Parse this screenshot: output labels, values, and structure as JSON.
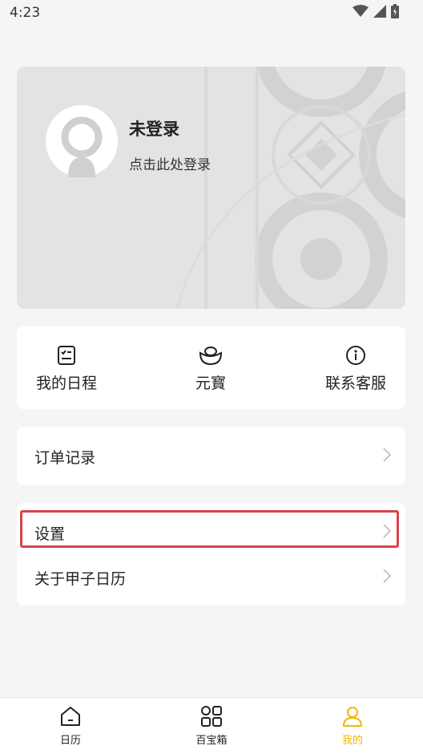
{
  "status_bar": {
    "time": "4:23"
  },
  "profile": {
    "title": "未登录",
    "subtitle": "点击此处登录"
  },
  "shortcuts": [
    {
      "label": "我的日程",
      "icon": "checklist-icon"
    },
    {
      "label": "元寳",
      "icon": "ingot-icon"
    },
    {
      "label": "联系客服",
      "icon": "info-icon"
    }
  ],
  "menu": {
    "order_records": "订单记录",
    "settings": "设置",
    "about": "关于甲子日历"
  },
  "tabbar": {
    "items": [
      {
        "label": "日历",
        "icon": "home-icon"
      },
      {
        "label": "百宝箱",
        "icon": "grid-icon"
      },
      {
        "label": "我的",
        "icon": "user-icon",
        "active": true
      }
    ]
  },
  "colors": {
    "accent": "#f0b800",
    "highlight": "#d9434a"
  }
}
